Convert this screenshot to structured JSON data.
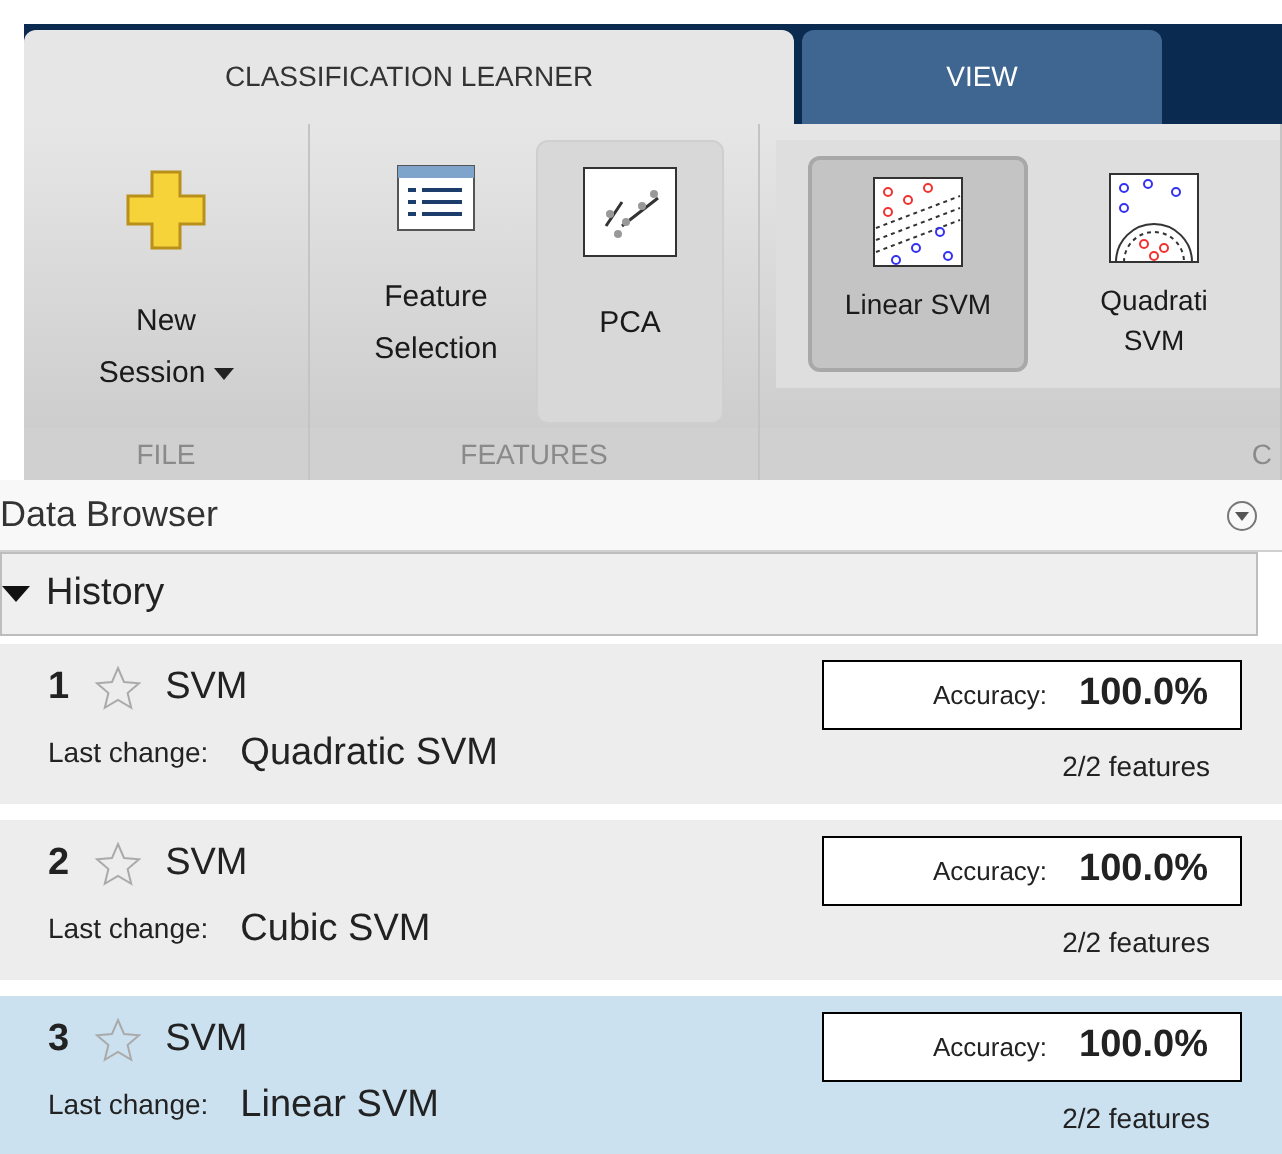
{
  "tabs": [
    {
      "label": "CLASSIFICATION LEARNER",
      "selected": true
    },
    {
      "label": "VIEW",
      "selected": false
    }
  ],
  "toolbar": {
    "sections": [
      {
        "label": "FILE",
        "buttons": [
          {
            "kind": "new",
            "label": "New Session",
            "dropdown": true
          }
        ]
      },
      {
        "label": "FEATURES",
        "buttons": [
          {
            "kind": "feature",
            "label": "Feature Selection"
          },
          {
            "kind": "pca",
            "label": "PCA",
            "framed": true
          }
        ]
      },
      {
        "label": "C",
        "gallery": [
          {
            "kind": "linear",
            "label": "Linear SVM",
            "selected": true
          },
          {
            "kind": "quadratic",
            "label": "Quadrati SVM",
            "selected": false
          }
        ]
      }
    ]
  },
  "data_browser": {
    "title": "Data Browser",
    "history": {
      "title": "History",
      "expanded": true,
      "models": [
        {
          "number": "1",
          "starred": false,
          "type": "SVM",
          "accuracy_label": "Accuracy:",
          "accuracy": "100.0%",
          "change_label": "Last change:",
          "change": "Quadratic SVM",
          "features": "2/2 features",
          "selected": false
        },
        {
          "number": "2",
          "starred": false,
          "type": "SVM",
          "accuracy_label": "Accuracy:",
          "accuracy": "100.0%",
          "change_label": "Last change:",
          "change": "Cubic SVM",
          "features": "2/2 features",
          "selected": false
        },
        {
          "number": "3",
          "starred": false,
          "type": "SVM",
          "accuracy_label": "Accuracy:",
          "accuracy": "100.0%",
          "change_label": "Last change:",
          "change": "Linear SVM",
          "features": "2/2 features",
          "selected": true
        }
      ]
    }
  }
}
